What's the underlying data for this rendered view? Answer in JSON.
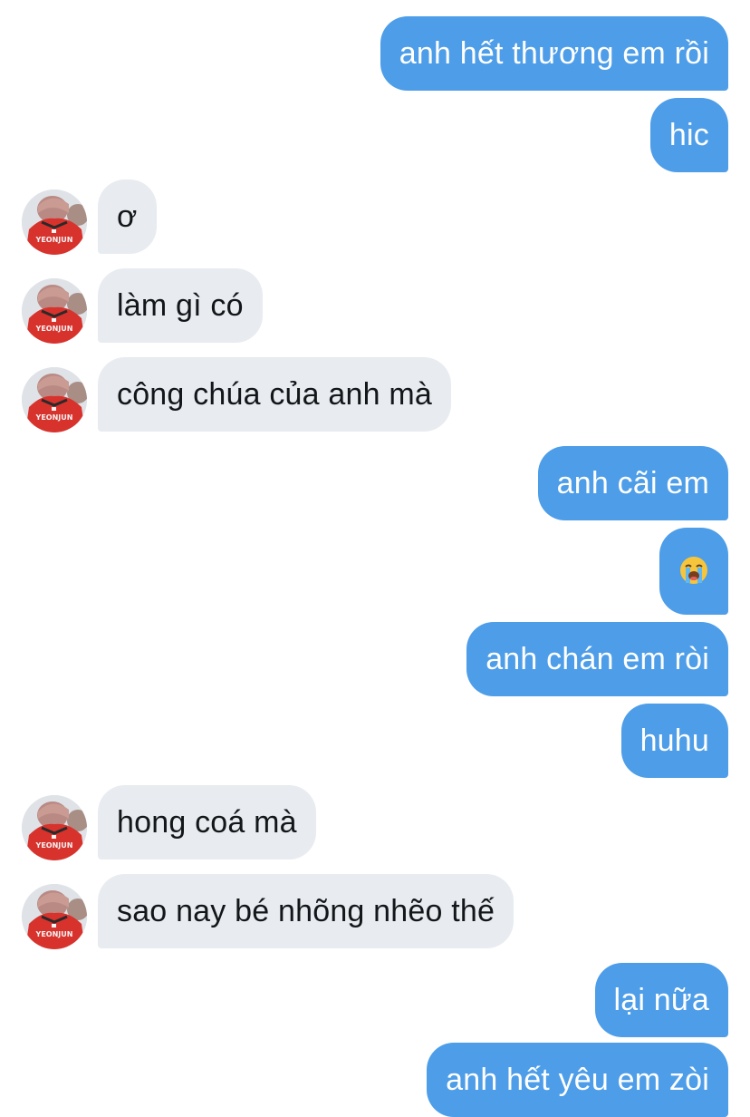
{
  "colors": {
    "outgoing_bubble": "#4d9de8",
    "incoming_bubble": "#e8ebef",
    "outgoing_text": "#ffffff",
    "incoming_text": "#14171a"
  },
  "messages": [
    {
      "direction": "outgoing",
      "text": "anh hết thương em rồi"
    },
    {
      "direction": "outgoing",
      "text": "hic"
    },
    {
      "direction": "incoming",
      "text": "ơ"
    },
    {
      "direction": "incoming",
      "text": "làm gì có"
    },
    {
      "direction": "incoming",
      "text": "công chúa của anh mà"
    },
    {
      "direction": "outgoing",
      "text": "anh cãi em"
    },
    {
      "direction": "outgoing",
      "icon": "loudly-crying-face-icon"
    },
    {
      "direction": "outgoing",
      "text": "anh chán em ròi"
    },
    {
      "direction": "outgoing",
      "text": "huhu"
    },
    {
      "direction": "incoming",
      "text": "hong coá mà"
    },
    {
      "direction": "incoming",
      "text": "sao nay bé nhõng nhẽo thế"
    },
    {
      "direction": "outgoing",
      "text": "lại nữa"
    },
    {
      "direction": "outgoing",
      "text": "anh hết yêu em zòi"
    }
  ],
  "avatar": {
    "icon": "contact-avatar-photo"
  }
}
